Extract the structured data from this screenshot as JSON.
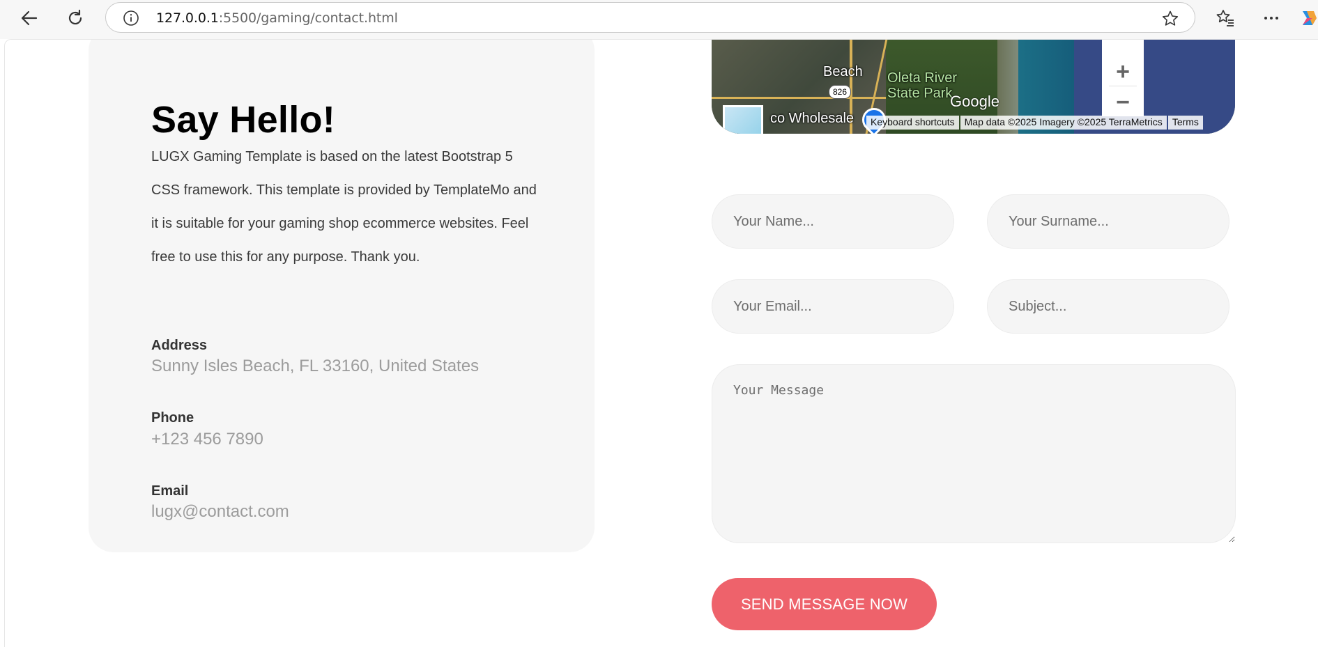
{
  "browser": {
    "url_host": "127.0.0.1",
    "url_rest": ":5500/gaming/contact.html",
    "icons": [
      "back-arrow-icon",
      "reload-icon",
      "info-icon",
      "star-icon",
      "favorites-icon",
      "more-icon",
      "copilot-icon"
    ]
  },
  "contact_card": {
    "title": "Say Hello!",
    "description": "LUGX Gaming Template is based on the latest Bootstrap 5 CSS framework. This template is provided by TemplateMo and it is suitable for your gaming shop ecommerce websites. Feel free to use this for any purpose. Thank you.",
    "address_label": "Address",
    "address_value": "Sunny Isles Beach, FL 33160, United States",
    "phone_label": "Phone",
    "phone_value": "+123 456 7890",
    "email_label": "Email",
    "email_value": "lugx@contact.com"
  },
  "map": {
    "labels": {
      "beach": "Beach",
      "park_line1": "Oleta River",
      "park_line2": "State Park",
      "store": "co Wholesale",
      "road_shield": "826",
      "brand": "Google"
    },
    "attribution": {
      "shortcuts": "Keyboard shortcuts",
      "data": "Map data ©2025 Imagery ©2025 TerraMetrics",
      "terms": "Terms"
    },
    "zoom_in": "+",
    "zoom_out": "−"
  },
  "form": {
    "name_placeholder": "Your Name...",
    "surname_placeholder": "Your Surname...",
    "email_placeholder": "Your Email...",
    "subject_placeholder": "Subject...",
    "message_placeholder": "Your Message",
    "submit_label": "SEND MESSAGE NOW"
  },
  "colors": {
    "accent": "#ee626b",
    "card_bg": "#f6f6f6",
    "field_bg": "#f5f5f5"
  }
}
